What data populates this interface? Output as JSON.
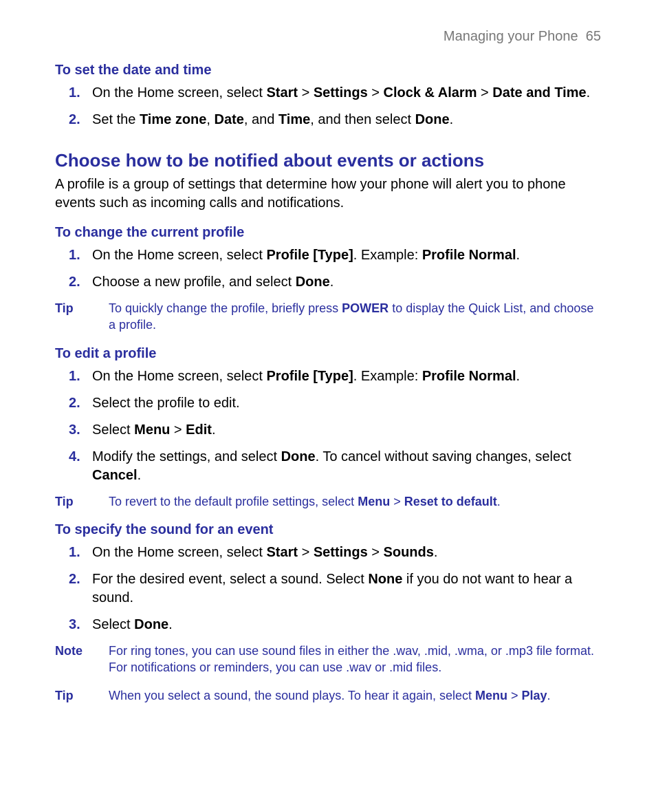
{
  "header": {
    "section": "Managing your Phone",
    "page": "65"
  },
  "s1": {
    "title": "To set the date and time",
    "step1_num": "1.",
    "step1_a": "On the Home screen, select ",
    "step1_b": "Start",
    "step1_c": " > ",
    "step1_d": "Settings",
    "step1_e": " > ",
    "step1_f": "Clock & Alarm",
    "step1_g": " > ",
    "step1_h": "Date and Time",
    "step1_i": ".",
    "step2_num": "2.",
    "step2_a": "Set the ",
    "step2_b": "Time zone",
    "step2_c": ", ",
    "step2_d": "Date",
    "step2_e": ", and ",
    "step2_f": "Time",
    "step2_g": ", and then select ",
    "step2_h": "Done",
    "step2_i": "."
  },
  "mh": "Choose how to be notified about events or actions",
  "intro": "A profile is a group of settings that determine how your phone will alert you to phone events such as incoming calls and notifications.",
  "s2": {
    "title": "To change the current profile",
    "step1_num": "1.",
    "step1_a": "On the Home screen, select ",
    "step1_b": "Profile [Type]",
    "step1_c": ". Example: ",
    "step1_d": "Profile Normal",
    "step1_e": ".",
    "step2_num": "2.",
    "step2_a": "Choose a new profile, and select ",
    "step2_b": "Done",
    "step2_c": ".",
    "tip_label": "Tip",
    "tip_a": "To quickly change the profile, briefly press ",
    "tip_b": "POWER",
    "tip_c": " to display the Quick List, and choose a profile."
  },
  "s3": {
    "title": "To edit a profile",
    "step1_num": "1.",
    "step1_a": "On the Home screen, select ",
    "step1_b": "Profile [Type]",
    "step1_c": ". Example: ",
    "step1_d": "Profile Normal",
    "step1_e": ".",
    "step2_num": "2.",
    "step2": "Select the profile to edit.",
    "step3_num": "3.",
    "step3_a": "Select ",
    "step3_b": "Menu",
    "step3_c": " > ",
    "step3_d": "Edit",
    "step3_e": ".",
    "step4_num": "4.",
    "step4_a": "Modify the settings, and select ",
    "step4_b": "Done",
    "step4_c": ". To cancel without saving changes, select ",
    "step4_d": "Cancel",
    "step4_e": ".",
    "tip_label": "Tip",
    "tip_a": "To revert to the default profile settings, select ",
    "tip_b": "Menu",
    "tip_c": " > ",
    "tip_d": "Reset to default",
    "tip_e": "."
  },
  "s4": {
    "title": "To specify the sound for an event",
    "step1_num": "1.",
    "step1_a": "On the Home screen, select ",
    "step1_b": "Start",
    "step1_c": " > ",
    "step1_d": "Settings",
    "step1_e": " > ",
    "step1_f": "Sounds",
    "step1_g": ".",
    "step2_num": "2.",
    "step2_a": "For the desired event, select a sound. Select ",
    "step2_b": "None",
    "step2_c": " if you do not want to hear a sound.",
    "step3_num": "3.",
    "step3_a": "Select ",
    "step3_b": "Done",
    "step3_c": ".",
    "note_label": "Note",
    "note": "For ring tones, you can use sound files in either the .wav, .mid, .wma, or .mp3 file format. For notifications or reminders, you can use .wav or .mid files.",
    "tip_label": "Tip",
    "tip_a": "When you select a sound, the sound plays. To hear it again, select ",
    "tip_b": "Menu",
    "tip_c": " > ",
    "tip_d": "Play",
    "tip_e": "."
  }
}
